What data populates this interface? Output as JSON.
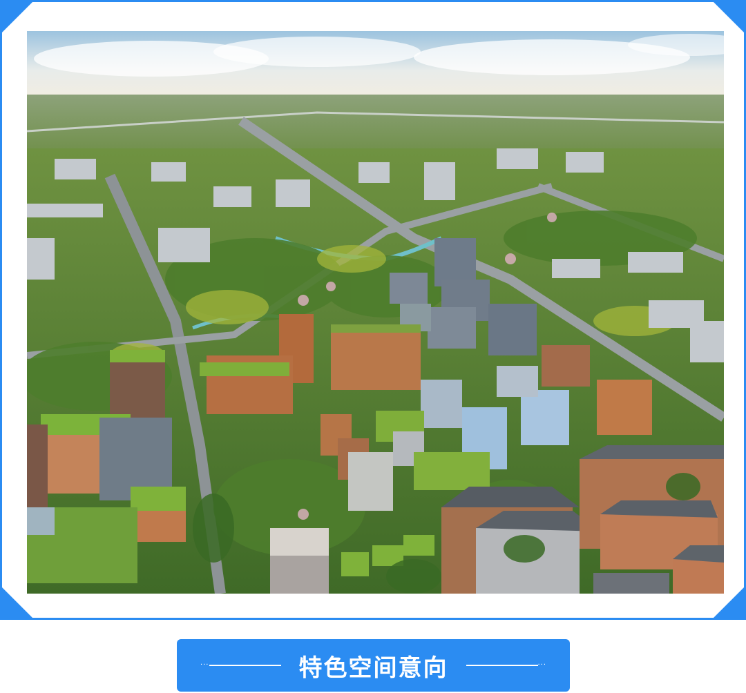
{
  "caption": {
    "title": "特色空间意向"
  },
  "colors": {
    "frame": "#2b8cf2",
    "caption_bg": "#2b8cf2",
    "caption_text": "#ffffff"
  },
  "image": {
    "subject": "aerial-city-rendering"
  }
}
